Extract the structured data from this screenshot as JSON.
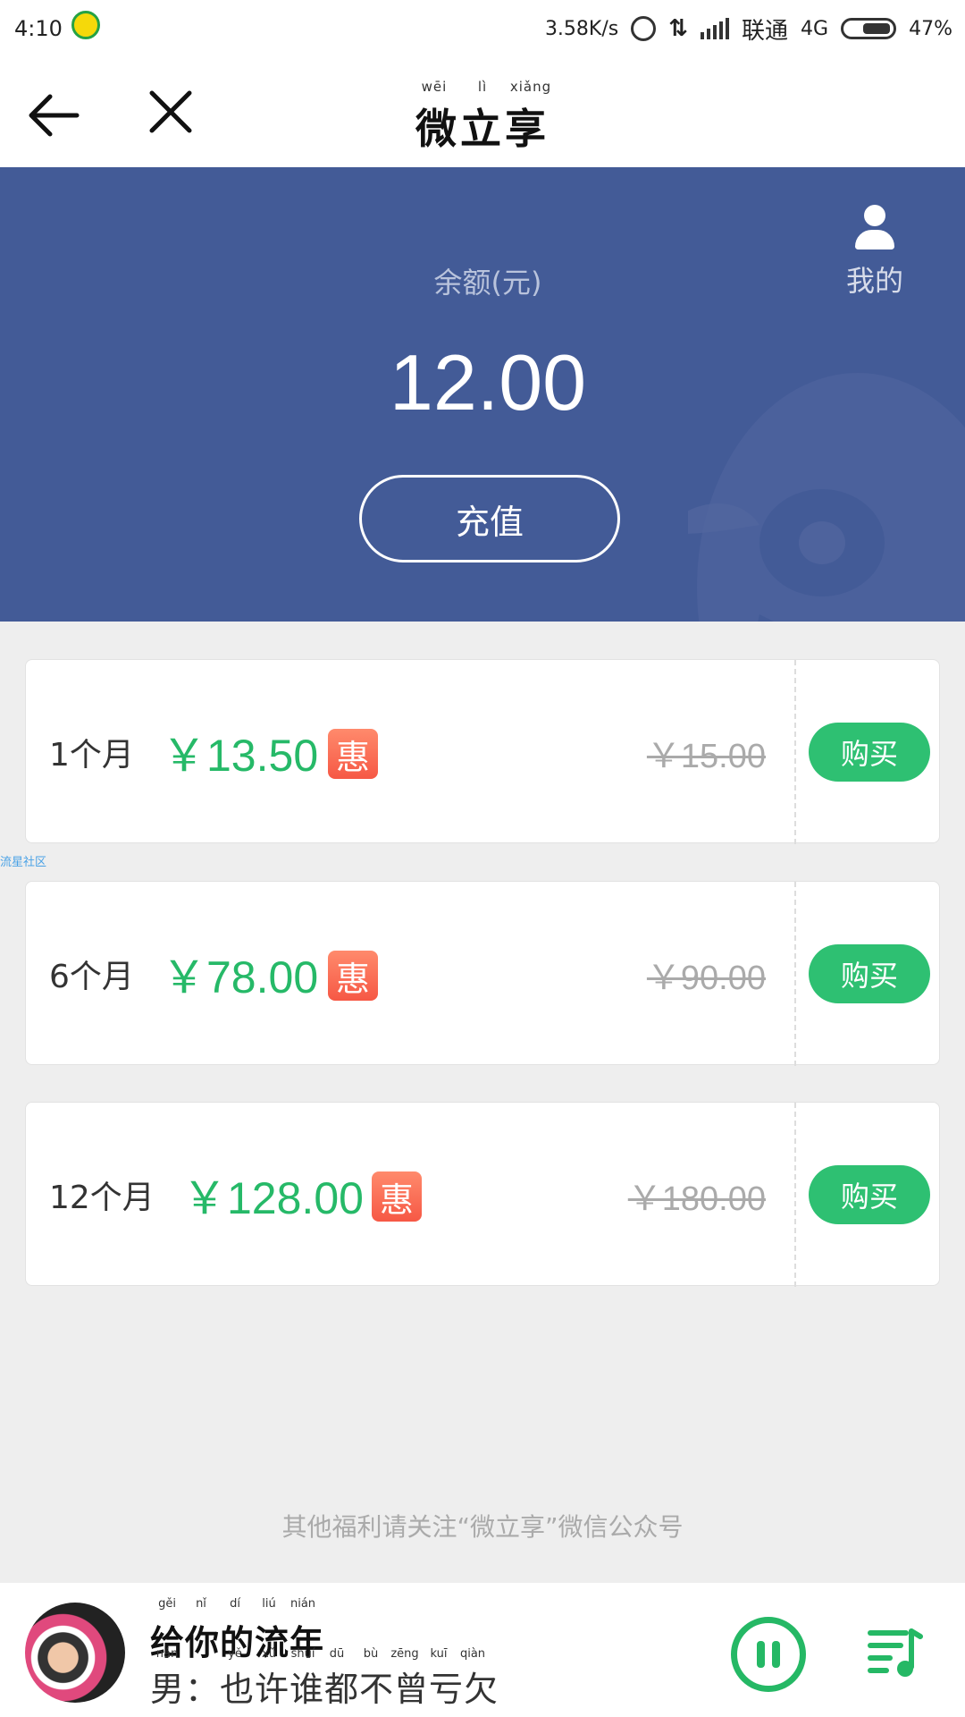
{
  "status_bar": {
    "time": "4:10",
    "network_speed": "3.58K/s",
    "carrier": "联通",
    "network_type": "4G",
    "battery": "47%",
    "icons": [
      "music-app-icon",
      "alarm-icon",
      "data-arrows-icon",
      "signal-icon",
      "battery-icon"
    ]
  },
  "nav": {
    "title": "微立享",
    "title_pinyin": [
      "wēi",
      "lì",
      "xiǎng"
    ],
    "back_icon": "arrow-left-icon",
    "close_icon": "close-icon"
  },
  "balance": {
    "label": "余额(元)",
    "amount": "12.00",
    "recharge_label": "充值",
    "mine_label": "我的",
    "background_color": "#435b97"
  },
  "plans": [
    {
      "duration": "1个月",
      "price": "￥13.50",
      "badge": "惠",
      "original_price": "￥15.00",
      "buy_label": "购买"
    },
    {
      "duration": "6个月",
      "price": "￥78.00",
      "badge": "惠",
      "original_price": "￥90.00",
      "buy_label": "购买"
    },
    {
      "duration": "12个月",
      "price": "￥128.00",
      "badge": "惠",
      "original_price": "￥180.00",
      "buy_label": "购买"
    }
  ],
  "watermark": "流星社区",
  "footer_note": "其他福利请关注“微立享”微信公众号",
  "player": {
    "song_title": "给你的流年",
    "title_pinyin": [
      "gěi",
      "nǐ",
      "dí",
      "liú",
      "nián"
    ],
    "lyric": "男：也许谁都不曾亏欠",
    "lyric_pinyin": [
      "nán",
      "",
      "yě",
      "xǔ",
      "shuí",
      "dū",
      "bù",
      "zēng",
      "kuī",
      "qiàn"
    ],
    "accent_color": "#25b865"
  },
  "colors": {
    "price_green": "#26b968",
    "buy_green": "#2ec072",
    "badge_red": "#f65845"
  }
}
